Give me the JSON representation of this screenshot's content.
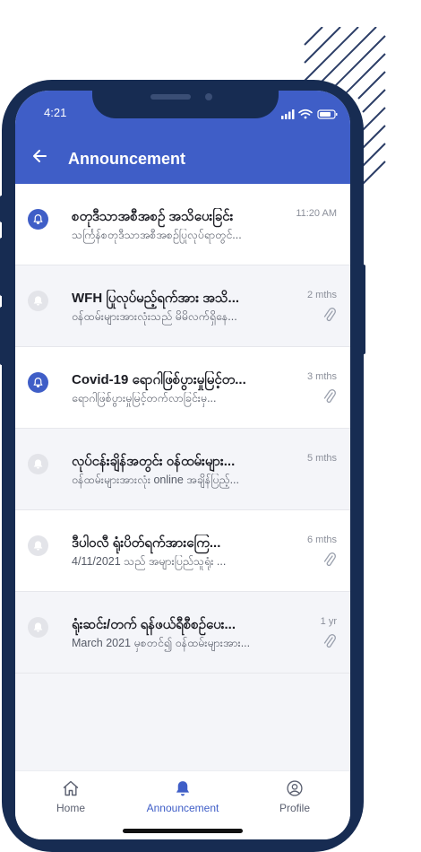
{
  "status_bar": {
    "time": "4:21"
  },
  "header": {
    "title": "Announcement"
  },
  "announcements": [
    {
      "title": "စတုဒီသာအစီအစဉ် အသိပေးခြင်း",
      "subtitle": "သင်္ကြန်စတုဒီသာအစီအစဉ်ပြုလုပ်ရာတွင်...",
      "time": "11:20 AM",
      "attachment": false,
      "unread": true
    },
    {
      "title": "WFH ပြုလုပ်မည့်ရက်အား အသိ...",
      "subtitle": "ဝန်ထမ်းများအားလုံးသည် မိမိလက်ရှိနေ...",
      "time": "2 mths",
      "attachment": true,
      "unread": false
    },
    {
      "title": "Covid-19 ရောဂါဖြစ်ပွားမှုမြင့်တ...",
      "subtitle": "ရောဂါဖြစ်ပွားမှုမြင့်တက်လာခြင်းမှ...",
      "time": "3 mths",
      "attachment": true,
      "unread": true
    },
    {
      "title": "လုပ်ငန်းချိန်အတွင်း ဝန်ထမ်းများ...",
      "subtitle": "ဝန်ထမ်းများအားလုံး online အချိန်ပြည့်...",
      "time": "5 mths",
      "attachment": false,
      "unread": false
    },
    {
      "title": "ဒီပါဝလီ ရုံးပိတ်ရက်အားကြေ...",
      "subtitle": "4/11/2021 သည် အများပြည်သူရုံး ...",
      "time": "6 mths",
      "attachment": true,
      "unread": false
    },
    {
      "title": "ရုံးဆင်း/တက် ရန်ဖယ်ရီစီစဉ်ပေး...",
      "subtitle": "March 2021 မှစတင်၍ ဝန်ထမ်းများအား...",
      "time": "1 yr",
      "attachment": true,
      "unread": false
    }
  ],
  "tabbar": {
    "home_label": "Home",
    "announcement_label": "Announcement",
    "profile_label": "Profile"
  },
  "colors": {
    "primary": "#3f5ec7",
    "frame": "#172c52",
    "inactive_bell": "#e3e4e9"
  }
}
